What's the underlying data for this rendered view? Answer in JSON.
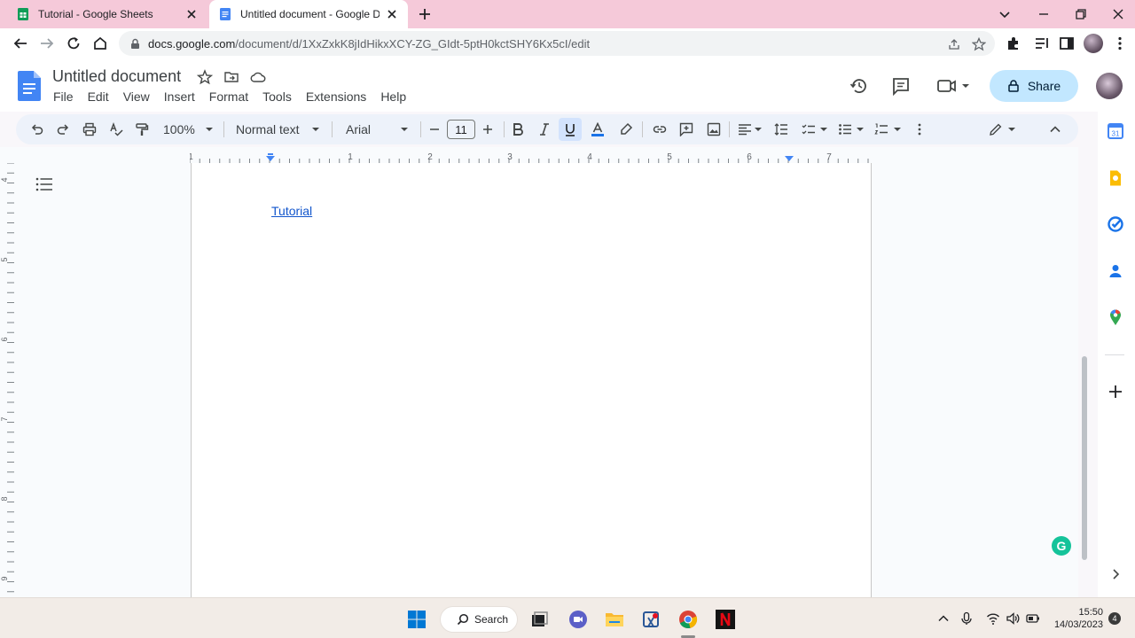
{
  "browser": {
    "tabs": [
      {
        "title": "Tutorial - Google Sheets",
        "icon": "sheets-icon",
        "active": false
      },
      {
        "title": "Untitled document - Google Docs",
        "icon": "docs-icon",
        "active": true
      }
    ],
    "url_host": "docs.google.com",
    "url_path": "/document/d/1XxZxkK8jIdHikxXCY-ZG_GIdt-5ptH0kctSHY6Kx5cI/edit"
  },
  "docs": {
    "title": "Untitled document",
    "menu": [
      "File",
      "Edit",
      "View",
      "Insert",
      "Format",
      "Tools",
      "Extensions",
      "Help"
    ],
    "share_label": "Share"
  },
  "toolbar": {
    "zoom": "100%",
    "style": "Normal text",
    "font": "Arial",
    "font_size": "11"
  },
  "ruler": {
    "h_labels": [
      "1",
      "1",
      "2",
      "3",
      "4",
      "5",
      "6",
      "7"
    ],
    "v_labels": [
      "4",
      "5",
      "6",
      "7",
      "8",
      "9"
    ]
  },
  "document": {
    "link_text": "Tutorial"
  },
  "taskbar": {
    "search_label": "Search",
    "time": "15:50",
    "date": "14/03/2023",
    "notification_count": "4"
  },
  "colors": {
    "accent": "#1a73e8",
    "share_bg": "#c2e7ff",
    "link": "#1155cc",
    "tabstrip": "#f5c9d9"
  }
}
